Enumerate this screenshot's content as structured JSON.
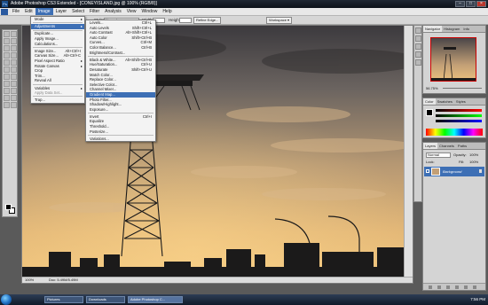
{
  "window": {
    "title": "Adobe Photoshop CS3 Extended - [CONEYISLAND.jpg @ 100% (RGB/8)]"
  },
  "menubar": [
    "File",
    "Edit",
    "Image",
    "Layer",
    "Select",
    "Filter",
    "Analysis",
    "View",
    "Window",
    "Help"
  ],
  "options": {
    "style_label": "Style:",
    "style_value": "Normal",
    "width_label": "Width:",
    "height_label": "Height:",
    "refine_label": "Refine Edge...",
    "workspace_label": "Workspace ▾"
  },
  "image_menu": [
    {
      "label": "Mode",
      "sub": true
    },
    {
      "sep": true
    },
    {
      "label": "Adjustments",
      "sub": true,
      "hl": true
    },
    {
      "sep": true
    },
    {
      "label": "Duplicate..."
    },
    {
      "label": "Apply Image..."
    },
    {
      "label": "Calculations..."
    },
    {
      "sep": true
    },
    {
      "label": "Image Size...",
      "sc": "Alt+Ctrl+I"
    },
    {
      "label": "Canvas Size...",
      "sc": "Alt+Ctrl+C"
    },
    {
      "label": "Pixel Aspect Ratio",
      "sub": true
    },
    {
      "label": "Rotate Canvas",
      "sub": true
    },
    {
      "label": "Crop"
    },
    {
      "label": "Trim..."
    },
    {
      "label": "Reveal All"
    },
    {
      "sep": true
    },
    {
      "label": "Variables",
      "sub": true
    },
    {
      "label": "Apply Data Set...",
      "dim": true
    },
    {
      "sep": true
    },
    {
      "label": "Trap..."
    }
  ],
  "adjustments_menu": [
    {
      "label": "Levels...",
      "sc": "Ctrl+L"
    },
    {
      "label": "Auto Levels",
      "sc": "Shift+Ctrl+L"
    },
    {
      "label": "Auto Contrast",
      "sc": "Alt+Shift+Ctrl+L"
    },
    {
      "label": "Auto Color",
      "sc": "Shift+Ctrl+B"
    },
    {
      "label": "Curves...",
      "sc": "Ctrl+M"
    },
    {
      "label": "Color Balance...",
      "sc": "Ctrl+B"
    },
    {
      "label": "Brightness/Contrast..."
    },
    {
      "sep": true
    },
    {
      "label": "Black & White...",
      "sc": "Alt+Shift+Ctrl+B"
    },
    {
      "label": "Hue/Saturation...",
      "sc": "Ctrl+U"
    },
    {
      "label": "Desaturate",
      "sc": "Shift+Ctrl+U"
    },
    {
      "label": "Match Color..."
    },
    {
      "label": "Replace Color..."
    },
    {
      "label": "Selective Color..."
    },
    {
      "label": "Channel Mixer..."
    },
    {
      "label": "Gradient Map...",
      "hl": true
    },
    {
      "label": "Photo Filter..."
    },
    {
      "label": "Shadow/Highlight..."
    },
    {
      "label": "Exposure..."
    },
    {
      "sep": true
    },
    {
      "label": "Invert",
      "sc": "Ctrl+I"
    },
    {
      "label": "Equalize"
    },
    {
      "label": "Threshold..."
    },
    {
      "label": "Posterize..."
    },
    {
      "sep": true
    },
    {
      "label": "Variations..."
    }
  ],
  "status": {
    "zoom": "100%",
    "doc": "Doc: 5.49M/5.49M"
  },
  "navigator": {
    "tabs": [
      "Navigator",
      "Histogram",
      "Info"
    ],
    "zoom": "56.75%"
  },
  "color_panel": {
    "tabs": [
      "Color",
      "Swatches",
      "Styles"
    ]
  },
  "layers_panel": {
    "tabs": [
      "Layers",
      "Channels",
      "Paths"
    ],
    "blend": "Normal",
    "opacity_label": "Opacity:",
    "opacity_value": "100%",
    "lock_label": "Lock:",
    "fill_label": "Fill:",
    "fill_value": "100%",
    "layer_name": "Background"
  },
  "taskbar": {
    "tasks": [
      "Pictures",
      "Downloads",
      "Adobe Photoshop C..."
    ],
    "clock": "7:56 PM"
  },
  "colors": {
    "accent": "#3d6fb5",
    "sky_top": "#3c3a3e",
    "sky_mid": "#c6a57c",
    "sky_horizon": "#f0c57d"
  }
}
